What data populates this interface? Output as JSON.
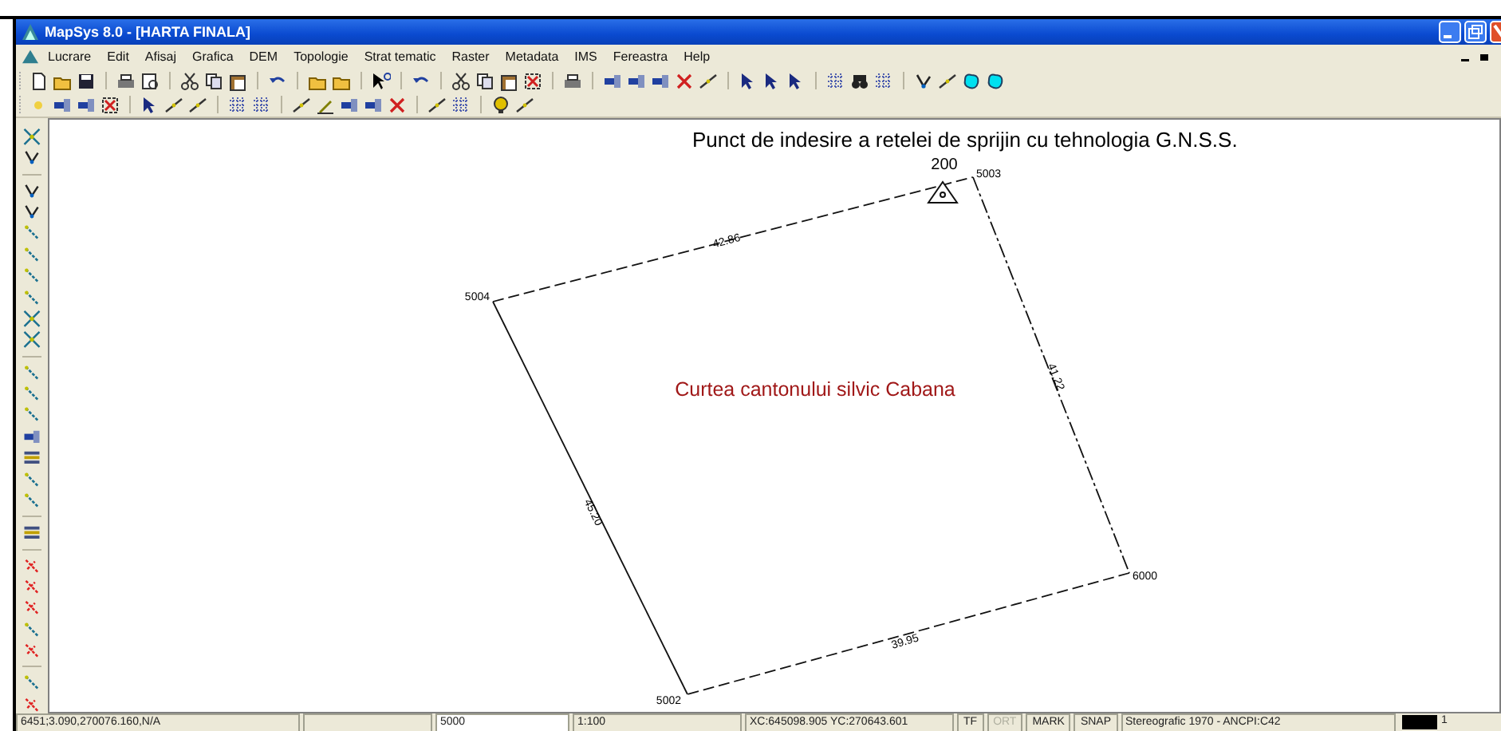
{
  "window": {
    "title": "MapSys 8.0 - [HARTA FINALA]"
  },
  "menu": [
    "Lucrare",
    "Edit",
    "Afisaj",
    "Grafica",
    "DEM",
    "Topologie",
    "Strat tematic",
    "Raster",
    "Metadata",
    "IMS",
    "Fereastra",
    "Help"
  ],
  "map": {
    "title": "Punct de indesire a retelei de sprijin cu tehnologia G.N.S.S.",
    "parcel_label": "Curtea cantonului silvic Cabana",
    "point_label": "200",
    "vertices": [
      "5004",
      "5003",
      "6000",
      "5002"
    ],
    "edges": [
      {
        "length": "42.86",
        "kind": "dashed"
      },
      {
        "length": "41.22",
        "kind": "dashdot"
      },
      {
        "length": "39.95",
        "kind": "dashed"
      },
      {
        "length": "45.20",
        "kind": "solid"
      }
    ]
  },
  "status_bar": [
    {
      "kind": "text",
      "text": "6451;3.090,270076.160,N/A"
    },
    {
      "kind": "blank"
    },
    {
      "kind": "field",
      "text": "5000"
    },
    {
      "kind": "text",
      "text": "1:100"
    },
    {
      "kind": "text",
      "text": "XC:645098.905 YC:270643.601"
    },
    {
      "kind": "toggle",
      "text": "TF",
      "disabled": false
    },
    {
      "kind": "toggle",
      "text": "ORT",
      "disabled": true
    },
    {
      "kind": "toggle",
      "text": "MARK",
      "disabled": false
    },
    {
      "kind": "toggle",
      "text": "SNAP",
      "disabled": false
    },
    {
      "kind": "text",
      "text": "Stereografic 1970 - ANCPI:C42"
    },
    {
      "kind": "swatch",
      "text": "1"
    }
  ]
}
